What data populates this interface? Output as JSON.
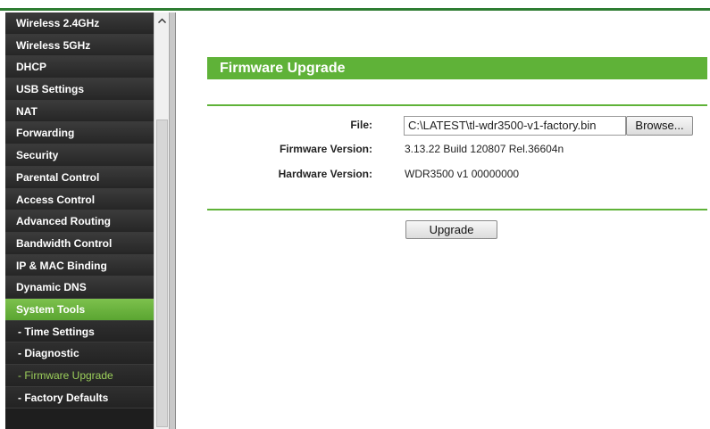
{
  "sidebar": {
    "items": [
      {
        "label": "Wireless 2.4GHz"
      },
      {
        "label": "Wireless 5GHz"
      },
      {
        "label": "DHCP"
      },
      {
        "label": "USB Settings"
      },
      {
        "label": "NAT"
      },
      {
        "label": "Forwarding"
      },
      {
        "label": "Security"
      },
      {
        "label": "Parental Control"
      },
      {
        "label": "Access Control"
      },
      {
        "label": "Advanced Routing"
      },
      {
        "label": "Bandwidth Control"
      },
      {
        "label": "IP & MAC Binding"
      },
      {
        "label": "Dynamic DNS"
      },
      {
        "label": "System Tools"
      },
      {
        "label": "- Time Settings"
      },
      {
        "label": "- Diagnostic"
      },
      {
        "label": "- Firmware Upgrade"
      },
      {
        "label": "- Factory Defaults"
      }
    ]
  },
  "main": {
    "title": "Firmware Upgrade",
    "file_label": "File:",
    "file_value": "C:\\LATEST\\tl-wdr3500-v1-factory.bin",
    "browse_label": "Browse...",
    "firmware_label": "Firmware Version:",
    "firmware_value": "3.13.22 Build 120807 Rel.36604n",
    "hardware_label": "Hardware Version:",
    "hardware_value": "WDR3500 v1 00000000",
    "upgrade_label": "Upgrade"
  },
  "colors": {
    "accent": "#5fb238",
    "sidebar_bg": "#1e1e1e",
    "active_sub_text": "#9ccf5b"
  }
}
